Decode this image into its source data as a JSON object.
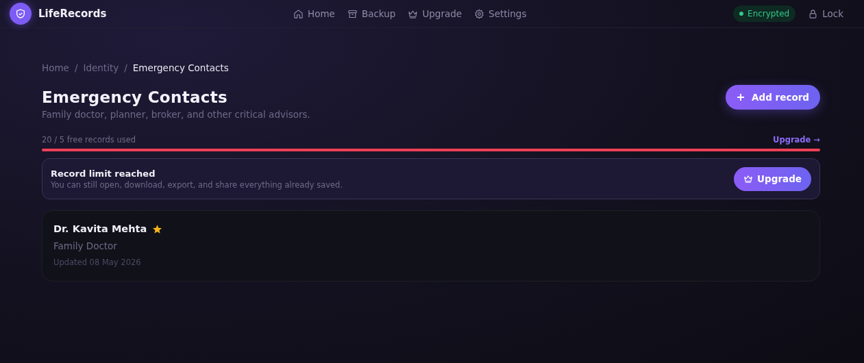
{
  "app": {
    "name": "LifeRecords"
  },
  "nav": [
    {
      "label": "Home"
    },
    {
      "label": "Backup"
    },
    {
      "label": "Upgrade"
    },
    {
      "label": "Settings"
    }
  ],
  "status_badge": "Encrypted",
  "lock_button": "Lock",
  "breadcrumb": [
    {
      "label": "Home",
      "current": false
    },
    {
      "label": "Identity",
      "current": false
    },
    {
      "label": "Emergency Contacts",
      "current": true
    }
  ],
  "breadcrumb_separator": "/",
  "page": {
    "title": "Emergency Contacts",
    "subtitle": "Family doctor, planner, broker, and other critical advisors.",
    "add_button": "Add record"
  },
  "usage": {
    "label": "20 / 5 free records used",
    "link": "Upgrade →",
    "level": 1
  },
  "limit_banner": {
    "title": "Record limit reached",
    "message": "You can still open, download, export, and share everything already saved.",
    "button": "Upgrade"
  },
  "records": [
    {
      "name": "Dr. Kavita Mehta",
      "favorite": true,
      "role": "Family Doctor",
      "updated": "Updated 08 May 2026"
    }
  ]
}
